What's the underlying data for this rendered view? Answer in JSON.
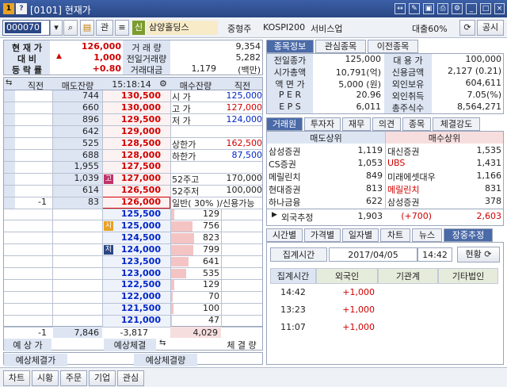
{
  "window": {
    "title": "[0101] 현재가"
  },
  "toolbar": {
    "code": "000070",
    "ticker_icon": "관",
    "badge": "신",
    "name": "삼양홀딩스",
    "sector": "중형주",
    "market": "KOSPI200",
    "industry": "서비스업",
    "margin": "대출60%",
    "notice_btn": "공시"
  },
  "summary": {
    "labels": [
      "현 재 가",
      "대    비",
      "등 락 률"
    ],
    "price": "126,000",
    "diff": "1,000",
    "rate": "+0.80",
    "vol_label": "거 래 량",
    "vol": "9,354",
    "prev_vol_label": "전일거래량",
    "prev_vol": "5,282",
    "amt_label": "거래대금",
    "amt": "1,179",
    "amt_unit": "(백만)"
  },
  "orderbook": {
    "headers": [
      "직전",
      "매도잔량",
      "15:18:14",
      "매수잔량",
      "직전"
    ],
    "asks": [
      {
        "qty": "744",
        "price": "130,500",
        "lab": "시 가",
        "val": "125,000",
        "vc": "blue"
      },
      {
        "qty": "660",
        "price": "130,000",
        "lab": "고 가",
        "val": "127,000",
        "vc": "red"
      },
      {
        "qty": "896",
        "price": "129,500",
        "lab": "저 가",
        "val": "124,000",
        "vc": "blue"
      },
      {
        "qty": "642",
        "price": "129,000",
        "lab": "",
        "val": "",
        "vc": ""
      },
      {
        "qty": "525",
        "price": "128,500",
        "lab": "상한가",
        "val": "162,500",
        "vc": "red"
      },
      {
        "qty": "688",
        "price": "128,000",
        "lab": "하한가",
        "val": "87,500",
        "vc": "blue"
      },
      {
        "qty": "1,955",
        "price": "127,500",
        "lab": "",
        "val": "",
        "vc": ""
      },
      {
        "qty": "1,039",
        "price": "127,000",
        "lab": "52주고",
        "val": "170,000",
        "vc": ""
      },
      {
        "qty": "614",
        "price": "126,500",
        "lab": "52주저",
        "val": "100,000",
        "vc": ""
      },
      {
        "qty": "83",
        "price": "126,000",
        "lab": "일반( 30% )/신용가능",
        "val": "",
        "vc": ""
      }
    ],
    "ask_last_prev": "-1",
    "ask_badge": "고",
    "bids": [
      {
        "price": "125,500",
        "qty": "129",
        "tag": ""
      },
      {
        "price": "125,000",
        "qty": "756",
        "tag": "시"
      },
      {
        "price": "124,500",
        "qty": "823",
        "tag": ""
      },
      {
        "price": "124,000",
        "qty": "799",
        "tag": "저"
      },
      {
        "price": "123,500",
        "qty": "641",
        "tag": ""
      },
      {
        "price": "123,000",
        "qty": "535",
        "tag": ""
      },
      {
        "price": "122,500",
        "qty": "129",
        "tag": ""
      },
      {
        "price": "122,000",
        "qty": "70",
        "tag": ""
      },
      {
        "price": "121,500",
        "qty": "100",
        "tag": ""
      },
      {
        "price": "121,000",
        "qty": "47",
        "tag": ""
      }
    ],
    "total_prev": "-1",
    "total_ask": "7,846",
    "total_diff": "-3,817",
    "total_bid": "4,029",
    "footer": [
      "예 상 가",
      "예상체결",
      "체 결 량"
    ],
    "expected": [
      "예상체결가",
      "예상체결량"
    ]
  },
  "info": {
    "tabs": [
      "종목정보",
      "관심종목",
      "이전종목"
    ],
    "rows": [
      [
        "전일종가",
        "125,000",
        "대 용 가",
        "100,000"
      ],
      [
        "시가총액",
        "10,791(억)",
        "신용금액",
        "2,127  (0.21)"
      ],
      [
        "액 면 가",
        "5,000 (원)",
        "외인보유",
        "604,611"
      ],
      [
        "P E R",
        "20.96",
        "외인취득",
        "7.05(%)"
      ],
      [
        "E P S",
        "6,011",
        "총주식수",
        "8,564,271"
      ]
    ]
  },
  "broker": {
    "tabs": [
      "거래원",
      "투자자",
      "재무",
      "의견",
      "종목",
      "체결강도"
    ],
    "sell_head": "매도상위",
    "buy_head": "매수상위",
    "rows": [
      [
        "삼성증권",
        "1,119",
        "대신증권",
        "1,535"
      ],
      [
        "CS증권",
        "1,053",
        "UBS",
        "1,431"
      ],
      [
        "메릴린치",
        "849",
        "미래에셋대우",
        "1,166"
      ],
      [
        "현대증권",
        "813",
        "메릴린치",
        "831"
      ],
      [
        "하나금융",
        "622",
        "삼성증권",
        "378"
      ]
    ],
    "foreign": [
      "외국추정",
      "1,903",
      "(+700)",
      "2,603"
    ]
  },
  "time": {
    "tabs": [
      "시간별",
      "가격별",
      "일자별",
      "차트",
      "뉴스",
      "장중추정"
    ],
    "label": "집계시간",
    "date": "2017/04/05",
    "clock": "14:42",
    "btn": "현황",
    "heads": [
      "집계시간",
      "외국인",
      "기관계",
      "기타법인"
    ],
    "rows": [
      [
        "14:42",
        "+1,000"
      ],
      [
        "13:23",
        "+1,000"
      ],
      [
        "11:07",
        "+1,000"
      ]
    ]
  },
  "bottom": [
    "차트",
    "시황",
    "주문",
    "기업",
    "관심"
  ]
}
